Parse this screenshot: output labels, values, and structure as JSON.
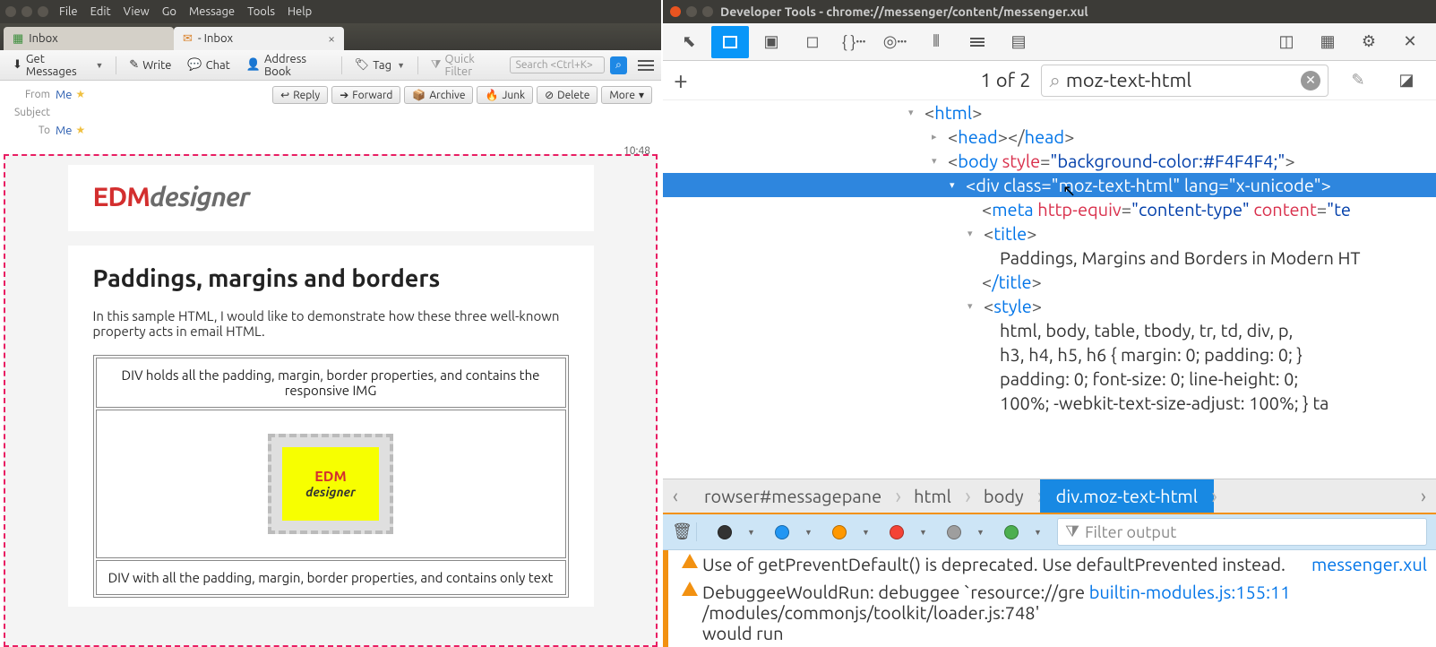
{
  "thunderbird": {
    "menu": [
      "File",
      "Edit",
      "View",
      "Go",
      "Message",
      "Tools",
      "Help"
    ],
    "tabs": {
      "inbox": "Inbox",
      "message": "- Inbox"
    },
    "toolbar": {
      "get_messages": "Get Messages",
      "write": "Write",
      "chat": "Chat",
      "address_book": "Address Book",
      "tag": "Tag",
      "quick_filter": "Quick Filter",
      "search_placeholder": "Search <Ctrl+K>"
    },
    "header": {
      "from_label": "From",
      "subject_label": "Subject",
      "to_label": "To",
      "from_value": "Me",
      "to_value": "Me",
      "time": "10:48",
      "actions": {
        "reply": "Reply",
        "forward": "Forward",
        "archive": "Archive",
        "junk": "Junk",
        "delete": "Delete",
        "more": "More"
      }
    },
    "email": {
      "logo_red": "EDM",
      "logo_gray": "designer",
      "title": "Paddings, margins and borders",
      "intro": "In this sample HTML, I would like to demonstrate how these three well-known property acts in email HTML.",
      "cell1": "DIV holds all the padding, margin, border properties, and contains the responsive IMG",
      "cell3": "DIV with all the padding, margin, border properties, and contains only text",
      "img_l1": "EDM",
      "img_l2": "designer"
    }
  },
  "devtools": {
    "title": "Developer Tools - chrome://messenger/content/messenger.xul",
    "search": {
      "count": "1 of 2",
      "query": "moz-text-html"
    },
    "tree": {
      "l1": {
        "tag": "html"
      },
      "l2": {
        "tag": "head"
      },
      "l3": {
        "tag": "body",
        "attr1n": "style",
        "attr1v": "\"background-color:#F4F4F4;\""
      },
      "l4": {
        "tag": "div",
        "attr1n": "class",
        "attr1v": "\"moz-text-html\"",
        "attr2n": "lang",
        "attr2v": "\"x-unicode\""
      },
      "l5": {
        "tag": "meta",
        "attr1n": "http-equiv",
        "attr1v": "\"content-type\"",
        "attr2n": "content",
        "attr2v": "\"te"
      },
      "l6": {
        "tag": "title"
      },
      "l7": "Paddings, Margins and Borders in Modern HT",
      "l8": {
        "tag": "/title"
      },
      "l9": {
        "tag": "style"
      },
      "l10": "html, body, table, tbody, tr, td, div, p,",
      "l11": "h3, h4, h5, h6 { margin: 0; padding: 0; }",
      "l12": "padding: 0; font-size: 0; line-height: 0;",
      "l13": "100%; -webkit-text-size-adjust: 100%; } ta"
    },
    "breadcrumbs": {
      "b1": "rowser#messagepane",
      "b2": "html",
      "b3": "body",
      "b4": "div.moz-text-html"
    },
    "console": {
      "filter_placeholder": "Filter output",
      "msg1": {
        "text1": "Use of getPreventDefault() is deprecated. Use defaultPrevented instead.",
        "src": "messenger.xul"
      },
      "msg2": {
        "text1": "DebuggeeWouldRun: debuggee `resource://gre/modules/commonjs/toolkit/loader.js:748' would run",
        "src": "builtin-modules.js",
        "line": "155:11"
      }
    }
  }
}
